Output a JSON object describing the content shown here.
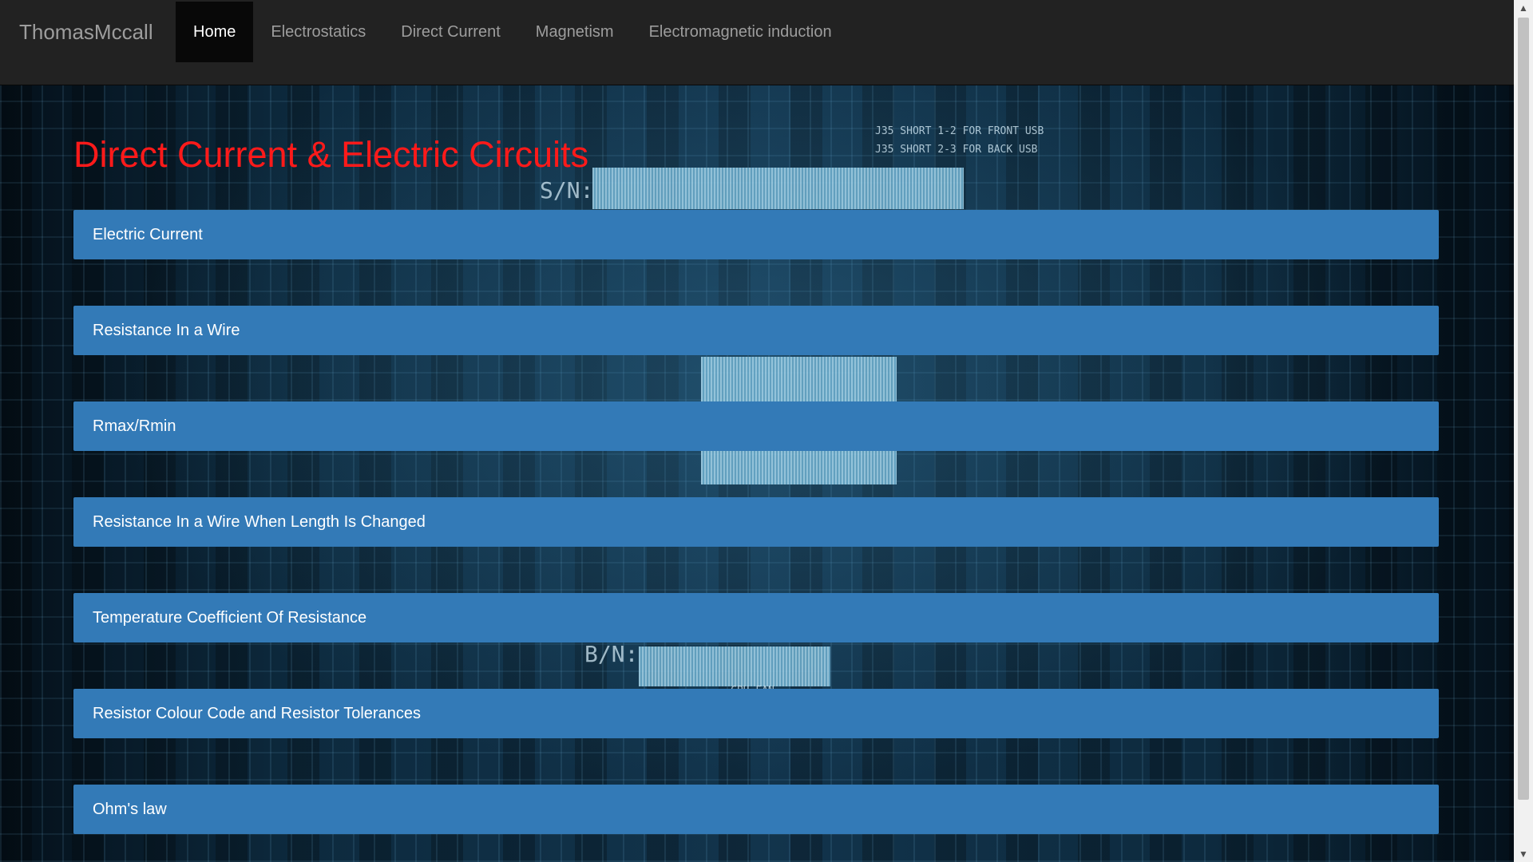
{
  "navbar": {
    "brand": "ThomasMccall",
    "items": [
      {
        "label": "Home",
        "active": true
      },
      {
        "label": "Electrostatics",
        "active": false
      },
      {
        "label": "Direct Current",
        "active": false
      },
      {
        "label": "Magnetism",
        "active": false
      },
      {
        "label": "Electromagnetic induction",
        "active": false
      }
    ]
  },
  "main": {
    "title": "Direct Current & Electric Circuits",
    "topics": [
      "Electric Current",
      "Resistance In a Wire",
      "Rmax/Rmin",
      "Resistance In a Wire When Length Is Changed",
      "Temperature Coefficient Of Resistance",
      "Resistor Colour Code and Resistor Tolerances",
      "Ohm's law"
    ]
  },
  "background_silkscreen": {
    "jumper_note_1": "J35 SHORT 1-2 FOR FRONT USB",
    "jumper_note_2": "J35 SHORT 2-3 FOR BACK USB",
    "serial_label_1": "S/N:",
    "serial_label_2": "B/N:",
    "fan_label": "CPU FAN"
  },
  "colors": {
    "navbar_bg": "#222222",
    "nav_active_bg": "#080808",
    "nav_text": "#9d9d9d",
    "title_red": "#ff1a1a",
    "topic_bar": "#337ab7"
  }
}
